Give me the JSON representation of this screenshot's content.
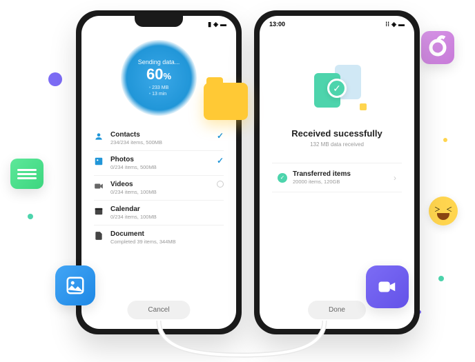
{
  "phone1": {
    "progress": {
      "label": "Sending data...",
      "percent": "60",
      "pct_sign": "%",
      "size": "233 MB",
      "time": "13 min"
    },
    "items": [
      {
        "title": "Contacts",
        "sub": "234/234 items, 500MB",
        "checked": true,
        "icon": "contact"
      },
      {
        "title": "Photos",
        "sub": "0/234 items, 500MB",
        "checked": true,
        "icon": "photo"
      },
      {
        "title": "Videos",
        "sub": "0/234 items, 100MB",
        "checked": false,
        "icon": "video"
      },
      {
        "title": "Calendar",
        "sub": "0/234 items, 100MB",
        "checked": null,
        "icon": "calendar"
      },
      {
        "title": "Document",
        "sub": "Completed 39 items, 344MB",
        "checked": null,
        "icon": "document"
      }
    ],
    "cancel": "Cancel"
  },
  "phone2": {
    "time": "13:00",
    "title": "Received sucessfully",
    "sub": "132 MB data received",
    "transfer": {
      "title": "Transferred items",
      "sub": "20000 items, 120GB"
    },
    "done": "Done"
  }
}
